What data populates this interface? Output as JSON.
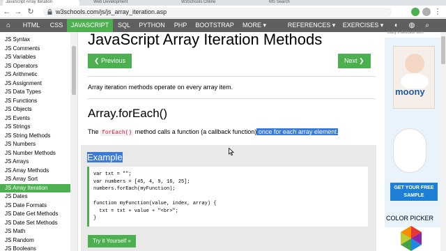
{
  "browser": {
    "tabs": [
      "JavaScript Array Iteration",
      "Web Development",
      "W3Schools Online",
      "MS Search"
    ],
    "url": "w3schools.com/js/js_array_iteration.asp"
  },
  "topnav": {
    "items": [
      "HTML",
      "CSS",
      "JAVASCRIPT",
      "SQL",
      "PYTHON",
      "PHP",
      "BOOTSTRAP",
      "MORE ▾"
    ],
    "right_items": [
      "REFERENCES ▾",
      "EXERCISES ▾"
    ],
    "active": "JAVASCRIPT"
  },
  "sidebar": {
    "items": [
      "JS Syntax",
      "JS Comments",
      "JS Variables",
      "JS Operators",
      "JS Arithmetic",
      "JS Assignment",
      "JS Data Types",
      "JS Functions",
      "JS Objects",
      "JS Events",
      "JS Strings",
      "JS String Methods",
      "JS Numbers",
      "JS Number Methods",
      "JS Arrays",
      "JS Array Methods",
      "JS Array Sort",
      "JS Array Iteration",
      "JS Dates",
      "JS Date Formats",
      "JS Date Get Methods",
      "JS Date Set Methods",
      "JS Math",
      "JS Random",
      "JS Booleans"
    ],
    "active": "JS Array Iteration"
  },
  "main": {
    "title": "JavaScript Array Iteration Methods",
    "prev_label": "❮ Previous",
    "next_label": "Next ❯",
    "intro": "Array iteration methods operate on every array item.",
    "section_title": "Array.forEach()",
    "desc_prefix": "The ",
    "desc_code": "forEach()",
    "desc_middle": " method calls a function (a callback function)",
    "desc_highlight": " once for each array element.",
    "example_title": "Example",
    "code_lines": [
      "var txt = \"\";",
      "var numbers = [45, 4, 9, 16, 25];",
      "numbers.forEach(myFunction);",
      "",
      "function myFunction(value, index, array) {",
      "  txt = txt + value + \"<br>\";",
      "}"
    ],
    "try_label": "Try it Yourself »"
  },
  "ad": {
    "top_text": "baby's delicate skin",
    "brand": "moony",
    "cta": "GET YOUR FREE SAMPLE",
    "color_picker": "COLOR PICKER"
  },
  "colors": {
    "nav_bg": "#5f5f5f",
    "accent": "#4CAF50",
    "selection": "#3a7bd5"
  }
}
